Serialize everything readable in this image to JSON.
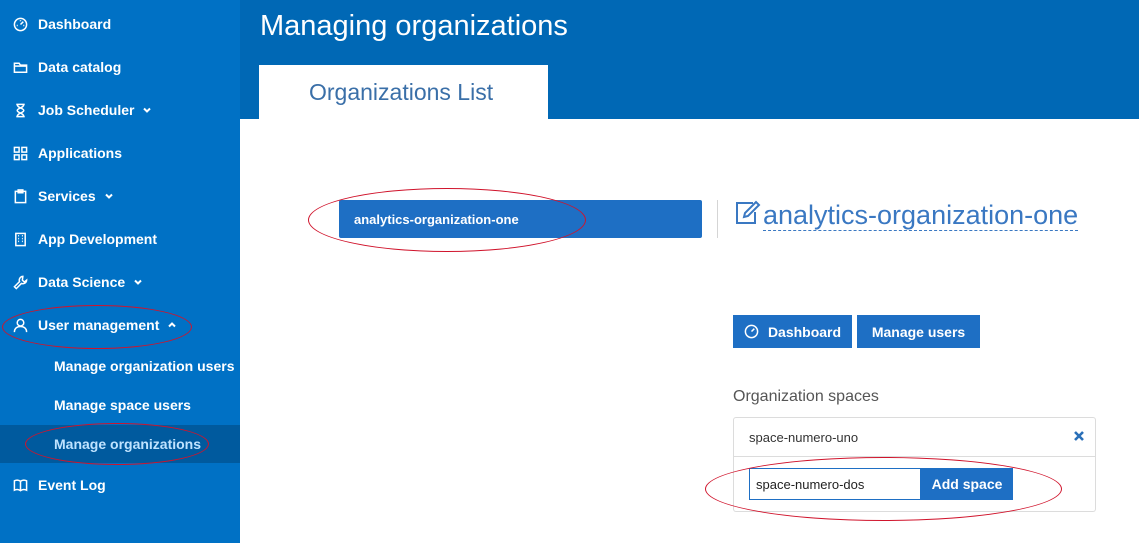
{
  "sidebar": {
    "items": [
      {
        "label": "Dashboard",
        "icon": "gauge-icon"
      },
      {
        "label": "Data catalog",
        "icon": "folder-icon"
      },
      {
        "label": "Job Scheduler",
        "icon": "hourglass-icon",
        "expandable": true
      },
      {
        "label": "Applications",
        "icon": "grid-icon"
      },
      {
        "label": "Services",
        "icon": "clipboard-icon",
        "expandable": true
      },
      {
        "label": "App Development",
        "icon": "building-icon"
      },
      {
        "label": "Data Science",
        "icon": "wrench-icon",
        "expandable": true
      },
      {
        "label": "User management",
        "icon": "user-icon",
        "expanded": true
      },
      {
        "label": "Event Log",
        "icon": "book-icon"
      }
    ],
    "submenu": [
      {
        "label": "Manage organization users"
      },
      {
        "label": "Manage space users"
      },
      {
        "label": "Manage organizations",
        "active": true
      }
    ]
  },
  "header": {
    "title": "Managing organizations",
    "tab": "Organizations List"
  },
  "organizations": [
    {
      "name": "analytics-organization-one",
      "selected": true
    }
  ],
  "detail": {
    "name": "analytics-organization-one",
    "dashboard_button": "Dashboard",
    "manage_users_button": "Manage users",
    "spaces_label": "Organization spaces",
    "spaces": [
      "space-numero-uno"
    ],
    "new_space_value": "space-numero-dos",
    "add_space_button": "Add space"
  },
  "colors": {
    "sidebar": "#0071c5",
    "header": "#0068b5",
    "accent": "#1e6fc4",
    "annotation": "#d0142c"
  }
}
